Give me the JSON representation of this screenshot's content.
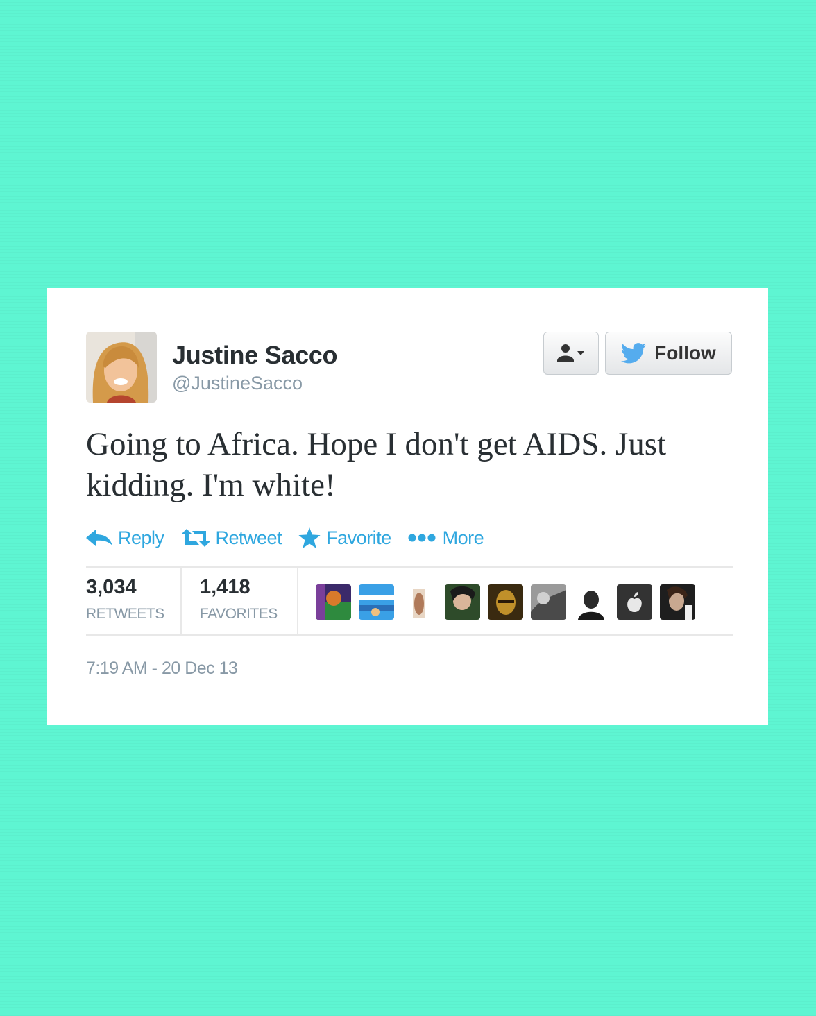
{
  "tweet": {
    "author_name": "Justine Sacco",
    "author_handle": "@JustineSacco",
    "text": "Going to Africa. Hope I don't get AIDS. Just kidding. I'm white!",
    "follow_label": "Follow",
    "actions": {
      "reply": "Reply",
      "retweet": "Retweet",
      "favorite": "Favorite",
      "more": "More"
    },
    "stats": {
      "retweets_count": "3,034",
      "retweets_label": "RETWEETS",
      "favorites_count": "1,418",
      "favorites_label": "FAVORITES"
    },
    "timestamp": "7:19 AM - 20 Dec 13"
  },
  "colors": {
    "background": "#5ef5d2",
    "link_blue": "#2fa7df",
    "twitter_bird": "#55acee"
  },
  "icons": [
    "user-dropdown-icon",
    "twitter-bird-icon",
    "reply-icon",
    "retweet-icon",
    "star-icon",
    "more-dots-icon"
  ]
}
